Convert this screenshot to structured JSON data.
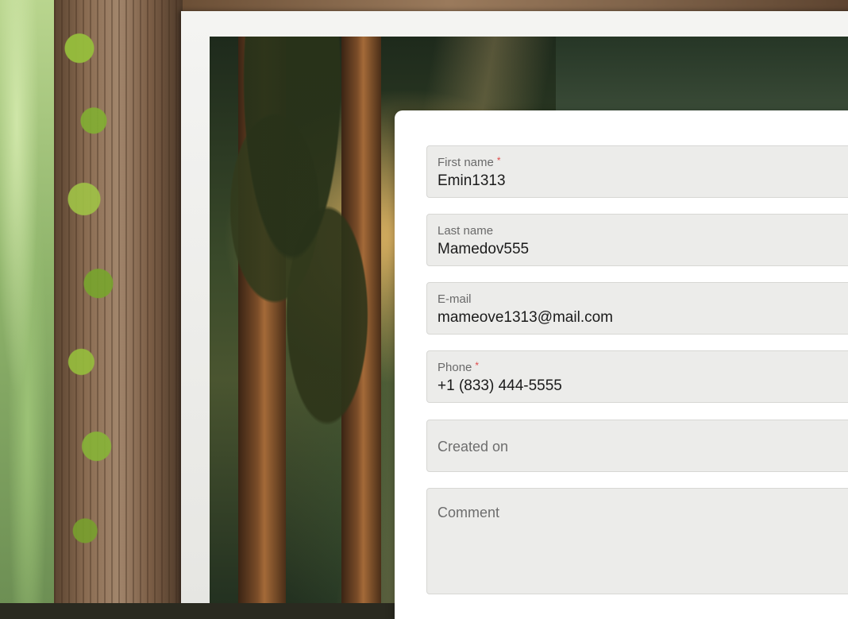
{
  "form": {
    "first_name": {
      "label": "First name",
      "required_mark": "*",
      "value": "Emin1313"
    },
    "last_name": {
      "label": "Last name",
      "value": "Mamedov555"
    },
    "email": {
      "label": "E-mail",
      "value": "mameove1313@mail.com"
    },
    "phone": {
      "label": "Phone",
      "required_mark": "*",
      "value": "+1 (833) 444-5555"
    },
    "created_on": {
      "placeholder": "Created on"
    },
    "comment": {
      "placeholder": "Comment"
    }
  },
  "colors": {
    "field_background": "#ececea",
    "required_mark": "#e04a4a",
    "card_background": "#ffffff"
  }
}
